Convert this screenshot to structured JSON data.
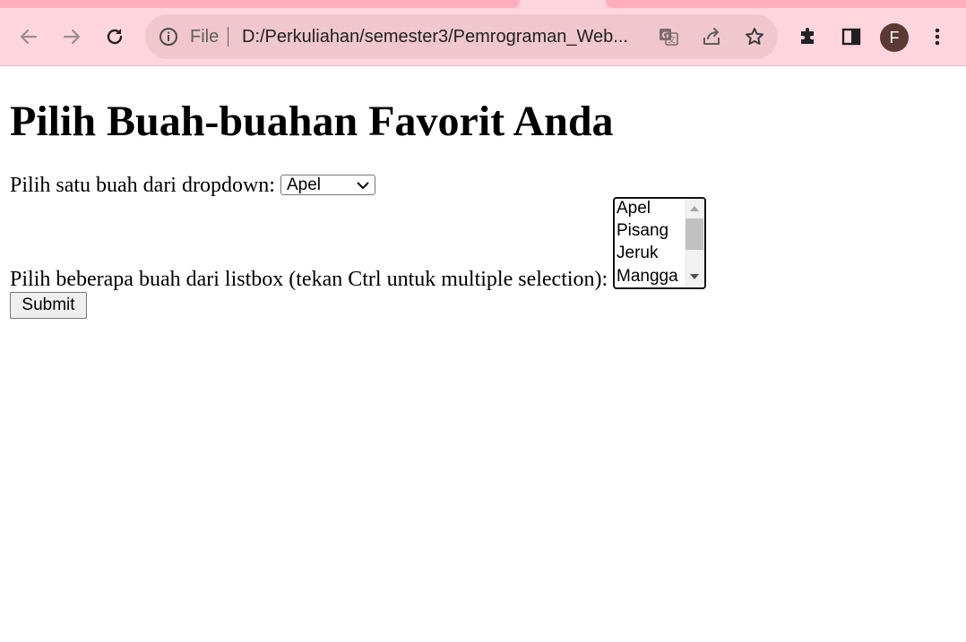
{
  "browser": {
    "address_scheme": "File",
    "address_url": "D:/Perkuliahan/semester3/Pemrograman_Web...",
    "profile_initial": "F",
    "colors": {
      "frame": "#ffd6dd",
      "omnibox": "#efc7cd",
      "avatar": "#5b3a33"
    },
    "icons": [
      "back-arrow-icon",
      "forward-arrow-icon",
      "reload-icon",
      "info-icon",
      "translate-icon",
      "share-icon",
      "bookmark-star-icon",
      "extensions-puzzle-icon",
      "side-panel-icon",
      "kebab-menu-icon"
    ]
  },
  "page": {
    "heading": "Pilih Buah-buahan Favorit Anda",
    "dropdown_label": "Pilih satu buah dari dropdown:",
    "dropdown_selected": "Apel",
    "listbox_label": "Pilih beberapa buah dari listbox (tekan Ctrl untuk multiple selection):",
    "listbox_options": [
      "Apel",
      "Pisang",
      "Jeruk",
      "Mangga"
    ],
    "submit_label": "Submit"
  }
}
